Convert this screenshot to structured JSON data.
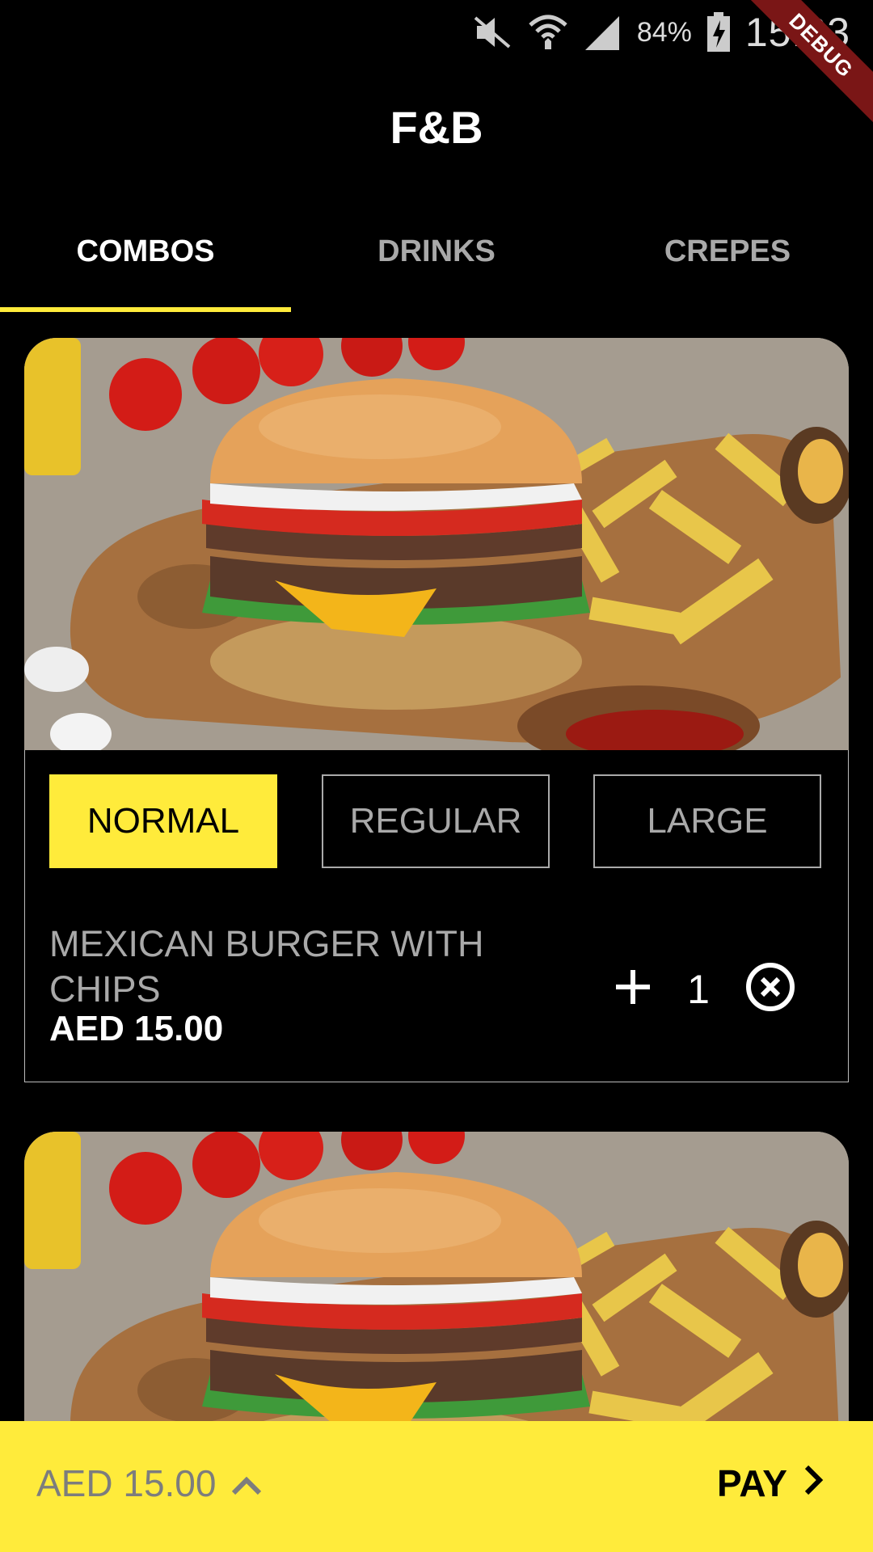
{
  "status_bar": {
    "battery_percent": "84%",
    "time": "15:33",
    "debug_label": "DEBUG",
    "icons": [
      "mute-icon",
      "wifi-icon",
      "signal-icon",
      "battery-charging-icon"
    ]
  },
  "header": {
    "title": "F&B"
  },
  "tabs": [
    {
      "label": "COMBOS",
      "active": true
    },
    {
      "label": "DRINKS",
      "active": false
    },
    {
      "label": "CREPES",
      "active": false
    }
  ],
  "items": [
    {
      "image": "burger-with-fries-photo",
      "sizes": [
        {
          "label": "NORMAL",
          "selected": true
        },
        {
          "label": "REGULAR",
          "selected": false
        },
        {
          "label": "LARGE",
          "selected": false
        }
      ],
      "name": "MEXICAN BURGER WITH CHIPS",
      "price": "AED 15.00",
      "quantity": "1"
    },
    {
      "image": "burger-with-fries-photo"
    }
  ],
  "footer": {
    "total": "AED 15.00",
    "pay_label": "PAY"
  },
  "colors": {
    "accent": "#ffeb3b",
    "background": "#000000",
    "muted_text": "#a9a9a9"
  }
}
